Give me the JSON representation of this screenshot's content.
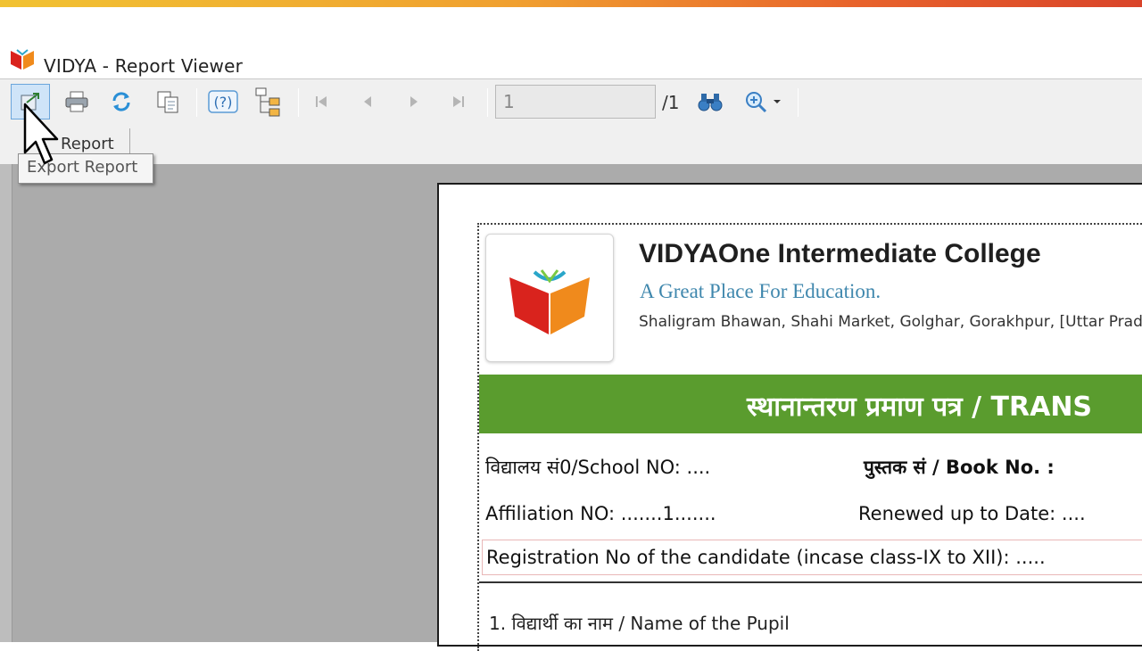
{
  "window": {
    "title": "VIDYA - Report Viewer",
    "accent_colors": [
      "#f1c232",
      "#e8632b",
      "#d9442a"
    ]
  },
  "toolbar": {
    "buttons": [
      {
        "name": "export-report-button",
        "icon": "export-icon"
      },
      {
        "name": "print-button",
        "icon": "printer-icon"
      },
      {
        "name": "refresh-button",
        "icon": "refresh-icon"
      },
      {
        "name": "copy-button",
        "icon": "copy-icon"
      },
      {
        "name": "help-button",
        "icon": "help-icon"
      },
      {
        "name": "group-tree-button",
        "icon": "tree-icon"
      },
      {
        "name": "first-page-button",
        "icon": "first-page-icon"
      },
      {
        "name": "previous-page-button",
        "icon": "previous-icon"
      },
      {
        "name": "next-page-button",
        "icon": "next-icon"
      },
      {
        "name": "last-page-button",
        "icon": "last-page-icon"
      },
      {
        "name": "find-button",
        "icon": "binoculars-icon"
      },
      {
        "name": "zoom-button",
        "icon": "zoom-icon"
      }
    ],
    "page_value": "1",
    "page_total": "/1",
    "tab_label": "Report",
    "tooltip": "Export Report"
  },
  "report": {
    "school_name": "VIDYAOne Intermediate College",
    "tagline": "A Great Place For Education.",
    "address": "Shaligram Bhawan, Shahi Market, Golghar, Gorakhpur, [Uttar Prad",
    "banner": "स्थानान्तरण प्रमाण पत्र / TRANS",
    "school_no": "विद्यालय सं0/School NO: ....",
    "book_no": "पुस्तक सं / Book No. :",
    "affiliation_no": "Affiliation NO: .......1.......",
    "renewed_up_to": "Renewed up to Date: ....",
    "registration": "Registration No of the candidate (incase class-IX to XII): .....",
    "pupil_name": "1. विद्यार्थी का नाम / Name of the Pupil",
    "band_color": "#5a9c2e",
    "tagline_color": "#3f87ad"
  }
}
